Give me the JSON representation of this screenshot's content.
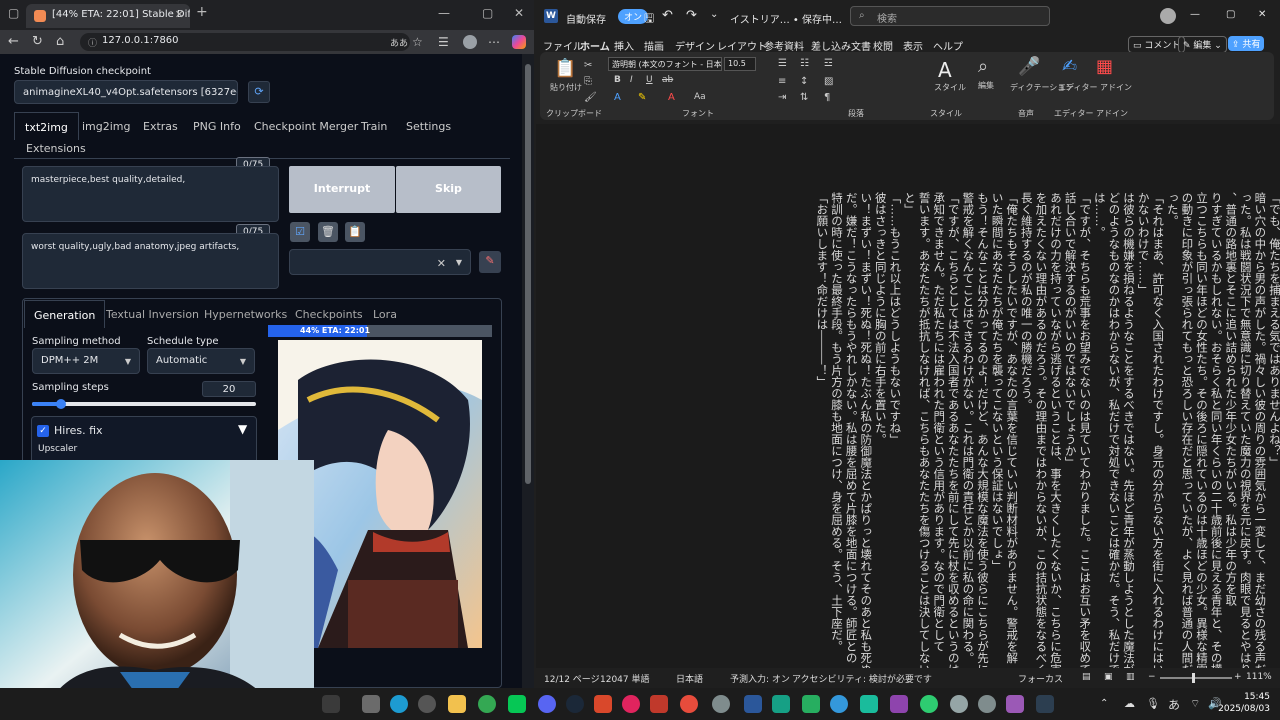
{
  "browser": {
    "tab_title": "[44% ETA: 22:01] Stable Diffusion",
    "url": "127.0.0.1:7860",
    "reader_label": "ああ"
  },
  "sd": {
    "checkpoint_label": "Stable Diffusion checkpoint",
    "checkpoint_value": "animagineXL40_v4Opt.safetensors [6327eca98t",
    "tabs": [
      "txt2img",
      "img2img",
      "Extras",
      "PNG Info",
      "Checkpoint Merger",
      "Train",
      "Settings",
      "Extensions"
    ],
    "prompt": "masterpiece,best quality,detailed,",
    "prompt_count": "0/75",
    "negative_prompt": "worst quality,ugly,bad anatomy,jpeg artifacts,",
    "negative_count": "0/75",
    "interrupt_label": "Interrupt",
    "skip_label": "Skip",
    "gen_tabs": [
      "Generation",
      "Textual Inversion",
      "Hypernetworks",
      "Checkpoints",
      "Lora"
    ],
    "sampling_method_label": "Sampling method",
    "sampling_method_value": "DPM++ 2M",
    "schedule_type_label": "Schedule type",
    "schedule_type_value": "Automatic",
    "sampling_steps_label": "Sampling steps",
    "sampling_steps_value": "20",
    "sampling_steps_fraction": 0.13,
    "hires_label": "Hires. fix",
    "upscaler_label": "Upscaler",
    "progress_text": "44% ETA: 22:01",
    "progress_fraction": 0.44
  },
  "word": {
    "autosave_label": "自動保存",
    "autosave_state": "オン",
    "doc_title": "イストリア… • 保存中…",
    "search_placeholder": "検索",
    "menus": [
      "ファイル",
      "ホーム",
      "挿入",
      "描画",
      "デザイン",
      "レイアウト",
      "参考資料",
      "差し込み文書",
      "校閲",
      "表示",
      "ヘルプ"
    ],
    "comment_btn": "コメント",
    "edit_btn": "編集",
    "share_btn": "共有",
    "font_name": "游明朝 (本文のフォント - 日本語)",
    "font_size": "10.5",
    "group_labels": [
      "クリップボード",
      "フォント",
      "段落",
      "スタイル",
      "音声",
      "エディター",
      "アドイン"
    ],
    "paste_label": "貼り付け",
    "style_label": "スタイル",
    "edit_label": "編集",
    "dictation_label": "ディクテーション",
    "editor_label": "エディター",
    "addin_label": "アドイン",
    "columns": [
      "「でも、俺たちを捕まえる気ではありませんよね？」",
      "暗い穴の中から男の声がした。禍々しい彼の周りの雰囲気から一変して、まだ幼さの残る声だ",
      "った。私は戦闘状況下で無意識に切り替えていた魔力の視界を元に戻す。肉眼で見るとやはりな",
      "、普通の路地裏とそこに追い詰められた少年少女たちがいる。私は少年の方を取",
      "りすぎているかもしれない。おそらく私と同い年くらいの二十歳前後に見える青年と、その横に",
      "立つこちらも同い年ほどの女性たち。その後ろに隠れているのは十歳ほどの少女。異様な精霊",
      "の動きに印象が引っ張られてもっと恐ろしい存在だと思っていたが、よく見れば普通の人間だ",
      "った。",
      "「それはまあ、許可なく入国されたわけですし。身元の分からない方を街に入れるわけにはい",
      "かないわけで……」",
      "は彼らの機嫌を損ねるようなことをするべきではない。先ほど青年が蒸動しようとした魔法が",
      "どのようなものなのかはわからないが、私だけで対処できないことは確かだ。そう、私だけで",
      "は……。",
      "「ですが、そちらも荒事をお望みでないのは見ていてわかりました。ここはお互い矛を収めて",
      "話し合いで解決するのがいいのではないでしょうか」",
      "あれだけの力を持っていながら逃げるということは、事を大きくしたくないか、こちらに危害",
      "を加えたくない理由があるのだろう。その理由まではわからないが、この拮抗状態をなるべく",
      "長く維持するのが私の唯一の勝機だろう。",
      "「俺たちもそうしたいですが、あなたの言葉を信じていい判断材料がありません。警戒を解",
      "いた瞬間にあなたたちが俺たちを襲ってこないという保証はないでしょ」",
      "もう！そんなことは分かってるのよ！だけど、あんな大規模な魔法を使う彼らにこちらが先に",
      "警戒を解くなんてことはできるわけがない。これは門衛の責任とか以前に私の命に関わる。",
      "「ですが、こちらとしては不法入国者であるあなたたちを前にして先に杖を収めるというのは",
      "承知できません。ただ私たちには雇われた門衛という信用があります。なので門衛として",
      "誓います。あなたたちが抵抗しなければ、こちらもあなたたちを傷つけることは決してしない",
      "と」",
      "「……もうこれ以上はどうしようもないですね」",
      "彼はさっきと同じように胸の前に右手を置いた。",
      "い！まずい！まずい！死ぬ！死ぬ！たぶん私の防御魔法とかぱりっと壊れてそのあと私も死ぬん",
      "だ。嫌だ！こうなったらもうやれしかない。私は腰を屈めて片膝を地面につける。師匠との",
      "特訓の時に使った最終手段。もう片方の膝も地面につけ、身を屈める。そう、土下座だ。",
      "「お願いします！命だけは―――！」"
    ],
    "status_page": "12/12 ページ",
    "status_words": "12047 単語",
    "status_lang": "日本語",
    "status_predict": "予測入力: オン",
    "status_access": "アクセシビリティ: 検討が必要です",
    "status_focus": "フォーカス",
    "zoom": "111%"
  },
  "taskbar": {
    "time": "15:45",
    "date": "2025/08/03",
    "ime": "あ"
  },
  "colors": {
    "sd_bg": "#0b0f19",
    "accent_blue": "#2563eb",
    "word_bg": "#1f1f1f"
  }
}
